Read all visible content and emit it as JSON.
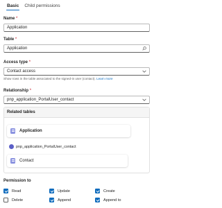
{
  "tabs": [
    {
      "label": "Basic",
      "active": true
    },
    {
      "label": "Child permissions",
      "active": false
    }
  ],
  "name": {
    "label": "Name",
    "value": "Application"
  },
  "table": {
    "label": "Table",
    "value": "Application",
    "icon": "search-icon"
  },
  "access_type": {
    "label": "Access type",
    "value": "Contact access",
    "help_text": "Show rows in the table associated to the signed-in user (contact).",
    "help_link": "Learn more"
  },
  "relationship": {
    "label": "Relationship",
    "value": "pnp_application_PortalUser_contact"
  },
  "related_tables": {
    "title": "Related tables",
    "source": "Application",
    "relationship": "pnp_application_PortalUser_contact",
    "target": "Contact"
  },
  "permissions": {
    "title": "Permission to",
    "items": [
      {
        "label": "Read",
        "checked": true
      },
      {
        "label": "Update",
        "checked": true
      },
      {
        "label": "Create",
        "checked": true
      },
      {
        "label": "Delete",
        "checked": false
      },
      {
        "label": "Append",
        "checked": true
      },
      {
        "label": "Append to",
        "checked": true
      }
    ]
  },
  "required_marker": "*",
  "accent_color": "#0f6cbd"
}
